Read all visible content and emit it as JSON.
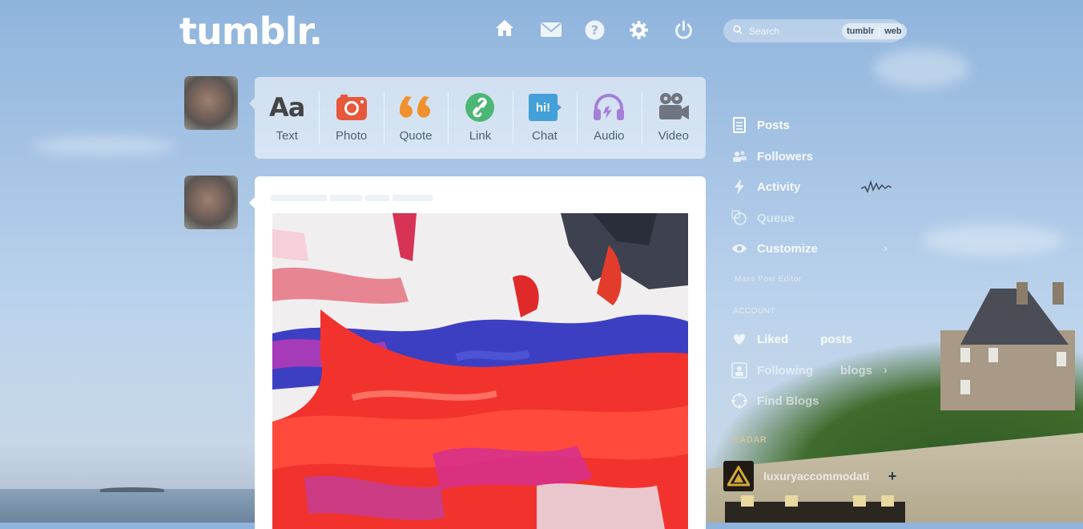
{
  "header": {
    "logo": "tumblr.",
    "nav": [
      {
        "name": "home-icon",
        "label": "Dashboard"
      },
      {
        "name": "mail-icon",
        "label": "Messages"
      },
      {
        "name": "help-icon",
        "label": "Help"
      },
      {
        "name": "gear-icon",
        "label": "Settings"
      },
      {
        "name": "power-icon",
        "label": "Log out"
      }
    ],
    "search": {
      "placeholder": "Search",
      "scope_tumblr": "tumblr",
      "scope_web": "web"
    }
  },
  "post_types": [
    {
      "label": "Text",
      "color": "#444444"
    },
    {
      "label": "Photo",
      "color": "#e7583c"
    },
    {
      "label": "Quote",
      "color": "#f0912d"
    },
    {
      "label": "Link",
      "color": "#4cb675"
    },
    {
      "label": "Chat",
      "color": "#44a0d8"
    },
    {
      "label": "Audio",
      "color": "#a57ed8"
    },
    {
      "label": "Video",
      "color": "#6f7580"
    }
  ],
  "sidebar": {
    "posts": "Posts",
    "followers": "Followers",
    "activity": "Activity",
    "queue": "Queue",
    "customize": "Customize",
    "mass_post_editor": "Mass Post Editor",
    "account_header": "ACCOUNT",
    "liked": "Liked",
    "liked_suffix": "posts",
    "following": "Following",
    "following_suffix": "blogs",
    "find_blogs": "Find Blogs",
    "radar_title": "RADAR",
    "radar_blog": "luxuryaccommodati"
  }
}
